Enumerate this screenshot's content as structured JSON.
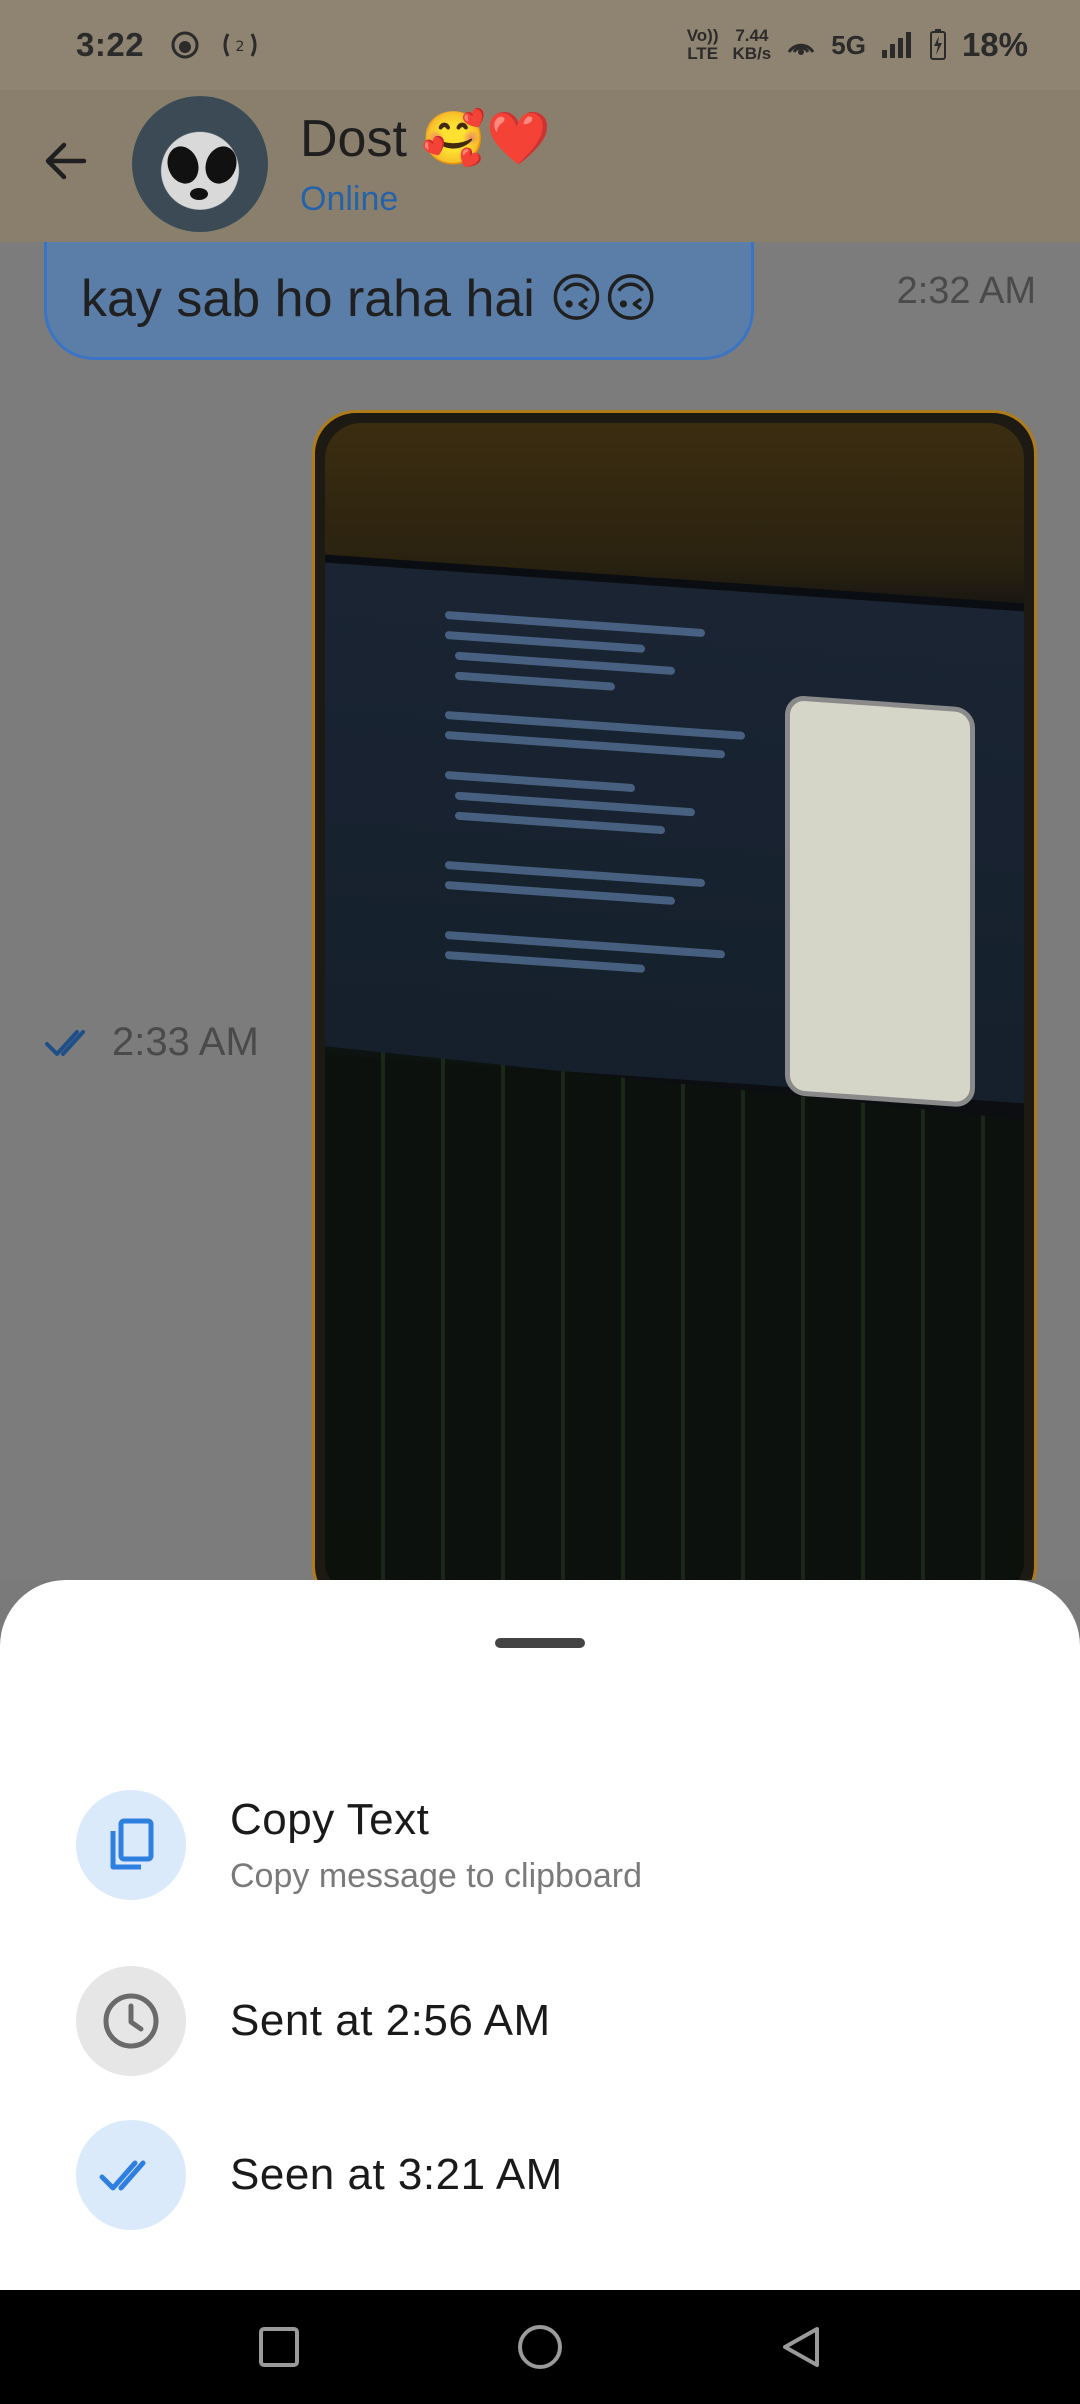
{
  "status_bar": {
    "time": "3:22",
    "network_speed_value": "7.44",
    "network_speed_unit": "KB/s",
    "volte_top": "Vo))",
    "volte_bottom": "LTE",
    "network_type": "5G",
    "battery": "18%"
  },
  "header": {
    "contact_name": "Dost 🥰❤️",
    "contact_status": "Online"
  },
  "messages": {
    "incoming_text": "kay sab ho raha hai 🙃🙃",
    "incoming_time": "2:32 AM",
    "outgoing_image_time": "2:33 AM"
  },
  "sheet": {
    "copy_title": "Copy Text",
    "copy_subtitle": "Copy message to clipboard",
    "sent_label": "Sent at 2:56 AM",
    "seen_label": "Seen at 3:21 AM"
  },
  "colors": {
    "accent_blue": "#2f7fe0",
    "icon_bg_blue": "#dbeafb",
    "icon_bg_grey": "#e6e6e6"
  }
}
